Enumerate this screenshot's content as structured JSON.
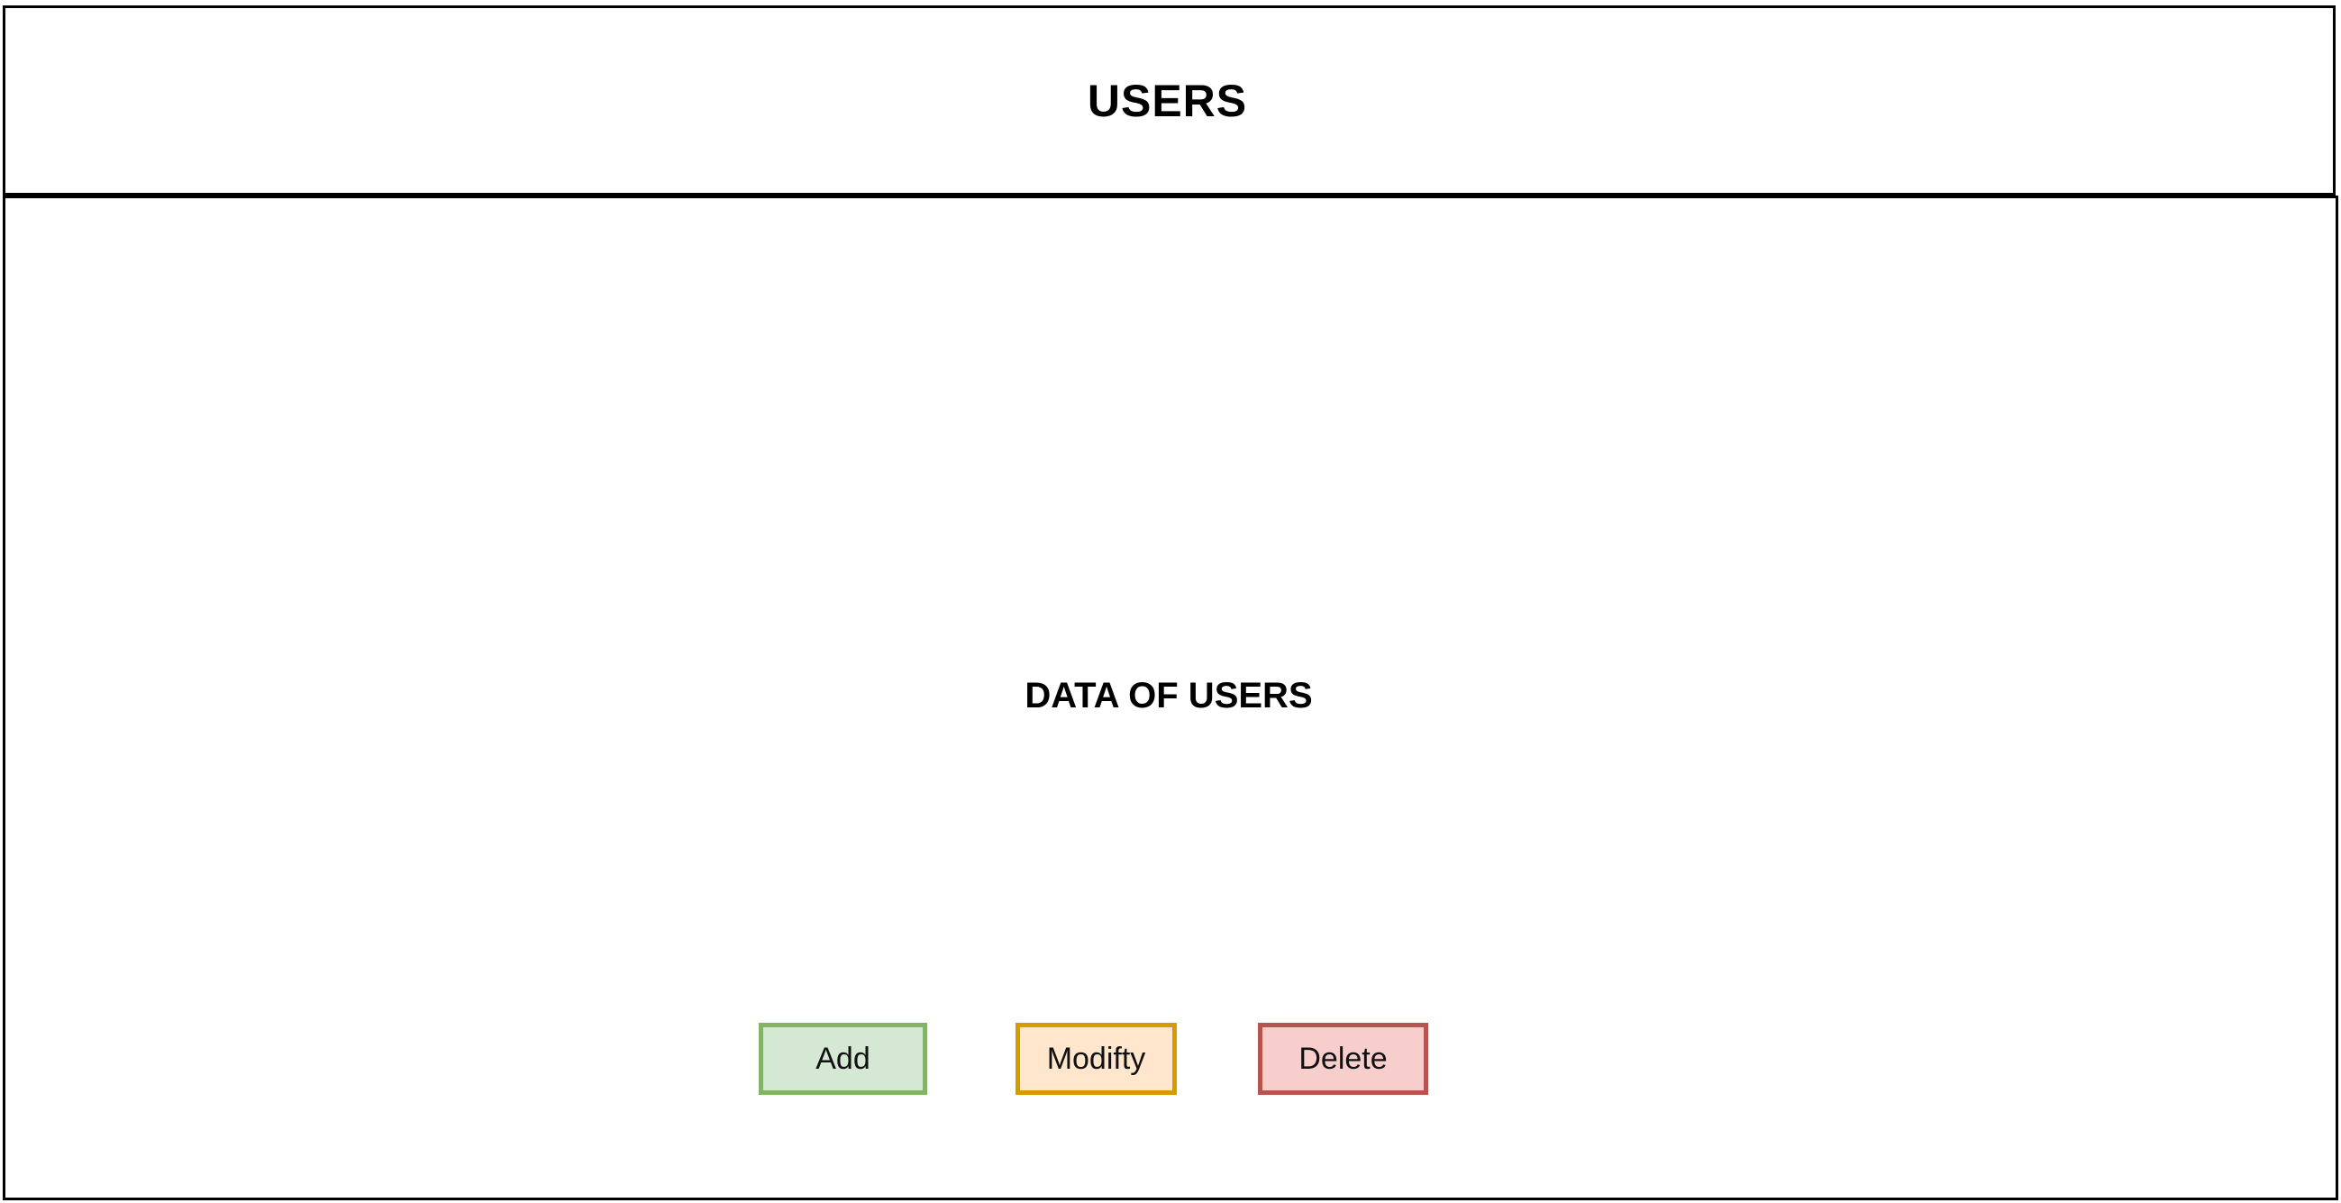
{
  "header": {
    "title": "USERS"
  },
  "main": {
    "content_label": "DATA OF USERS"
  },
  "actions": {
    "add": {
      "label": "Add",
      "fill": "#d5e8d4",
      "border": "#82b366"
    },
    "modify": {
      "label": "Modifty",
      "fill": "#ffe6cc",
      "border": "#d79b00"
    },
    "delete": {
      "label": "Delete",
      "fill": "#f8cecc",
      "border": "#b85450"
    }
  }
}
